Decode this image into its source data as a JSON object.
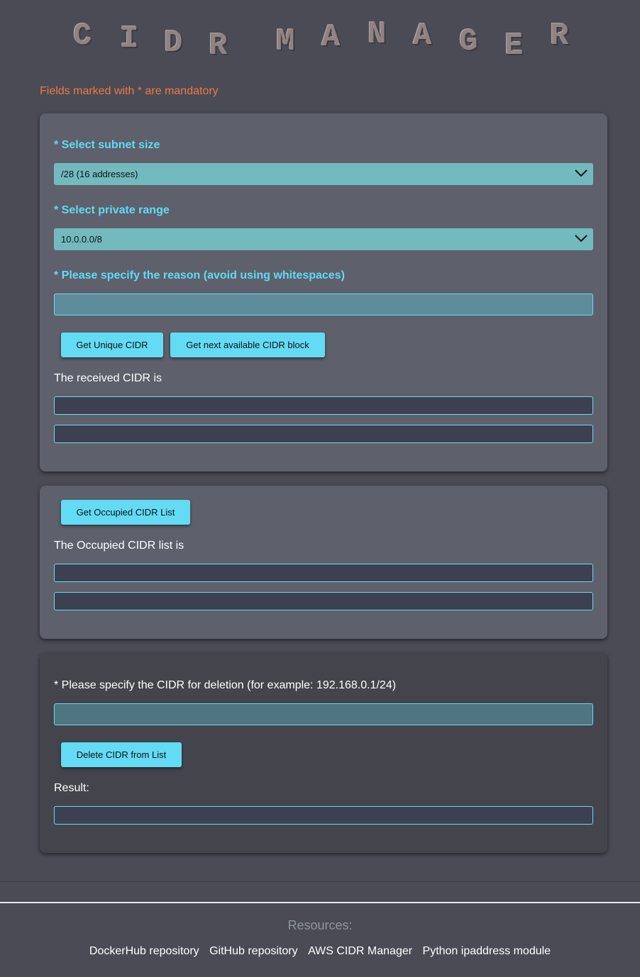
{
  "title_letters": [
    "C",
    "I",
    "D",
    "R",
    "M",
    "A",
    "N",
    "A",
    "G",
    "E",
    "R"
  ],
  "mandatory_note": "Fields marked with * are mandatory",
  "panel1": {
    "subnet_label": "* Select subnet size",
    "subnet_value": "/28 (16 addresses)",
    "range_label": "* Select private range",
    "range_value": "10.0.0.0/8",
    "reason_label": "* Please specify the reason (avoid using whitespaces)",
    "reason_value": "",
    "btn_unique": "Get Unique CIDR",
    "btn_next": "Get next available CIDR block",
    "received_label": "The received CIDR is"
  },
  "panel2": {
    "btn_occupied": "Get Occupied CIDR List",
    "occupied_label": "The Occupied CIDR list is"
  },
  "panel3": {
    "delete_label": "* Please specify the CIDR for deletion (for example: 192.168.0.1/24)",
    "btn_delete": "Delete CIDR from List",
    "result_label": "Result:"
  },
  "footer": {
    "resources": "Resources:",
    "links": [
      "DockerHub repository",
      "GitHub repository",
      "AWS CIDR Manager",
      "Python ipaddress module"
    ]
  },
  "icons": {
    "dropdown": "chevron-down-icon"
  },
  "colors": {
    "accent": "#63dbf4",
    "warning": "#ee7a44",
    "background": "#4a4b55"
  }
}
